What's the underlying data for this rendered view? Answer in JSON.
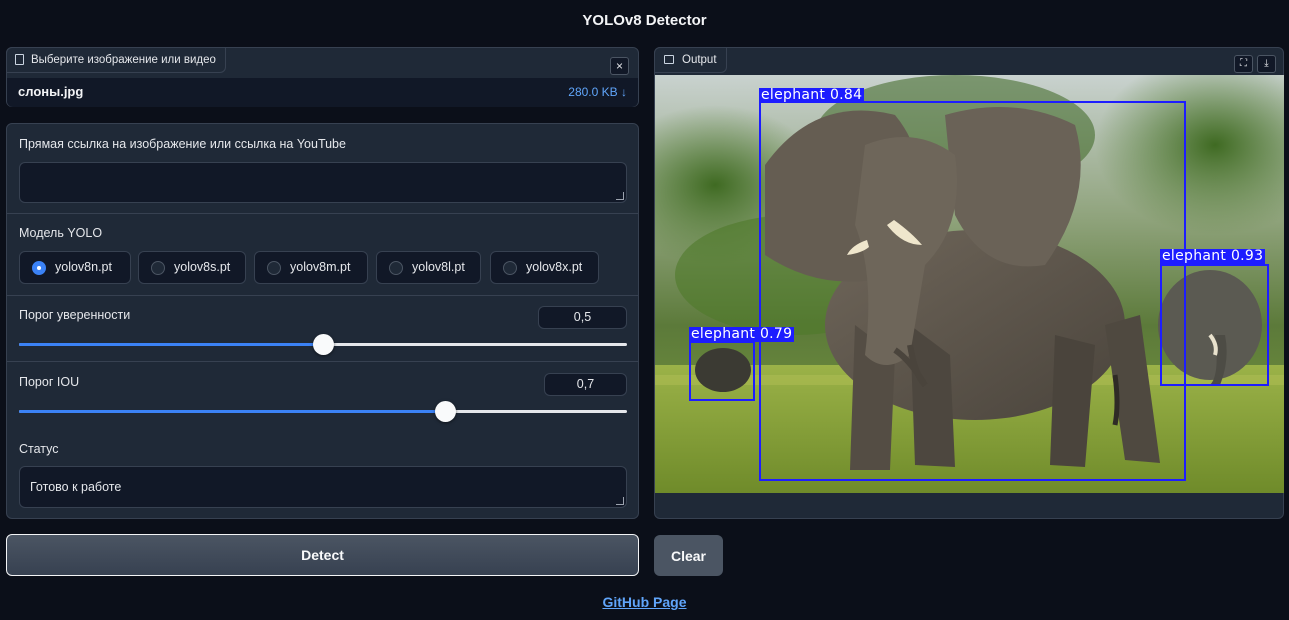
{
  "app": {
    "title": "YOLOv8 Detector"
  },
  "file_input": {
    "label": "Выберите изображение или видео",
    "close_icon": "×",
    "file_name": "слоны.jpg",
    "file_size": "280.0 KB ↓"
  },
  "url_input": {
    "label": "Прямая ссылка на изображение или ссылка на YouTube",
    "value": ""
  },
  "model": {
    "label": "Модель YOLO",
    "options": [
      "yolov8n.pt",
      "yolov8s.pt",
      "yolov8m.pt",
      "yolov8l.pt",
      "yolov8x.pt"
    ],
    "selected": "yolov8n.pt"
  },
  "confidence": {
    "label": "Порог уверенности",
    "value": "0,5",
    "fraction": 0.5
  },
  "iou": {
    "label": "Порог IOU",
    "value": "0,7",
    "fraction": 0.7
  },
  "status": {
    "label": "Статус",
    "value": "Готово к работе"
  },
  "output": {
    "label": "Output",
    "fullscreen_icon": "⛶",
    "download_icon": "⤓",
    "detections": [
      {
        "label": "elephant 0.84"
      },
      {
        "label": "elephant 0.93"
      },
      {
        "label": "elephant 0.79"
      }
    ]
  },
  "buttons": {
    "detect": "Detect",
    "clear": "Clear"
  },
  "footer": {
    "link": "GitHub Page"
  },
  "colors": {
    "accent": "#3b82f6",
    "box": "#1d1dff",
    "background": "#0b0f19",
    "panel": "#1f2937"
  }
}
